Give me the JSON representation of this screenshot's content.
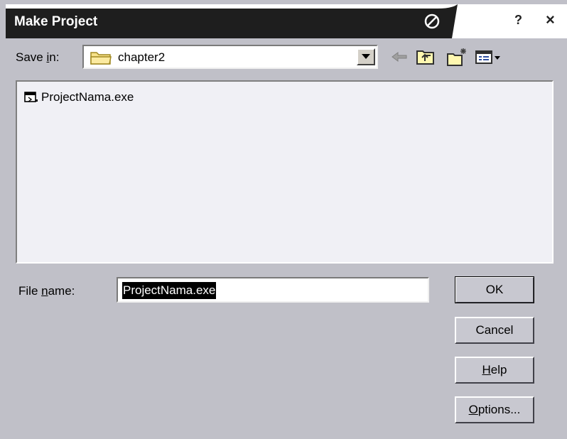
{
  "window": {
    "title": "Make Project",
    "help_label": "?",
    "close_label": "×"
  },
  "save_in": {
    "label_pre": "Save ",
    "label_accel": "i",
    "label_post": "n:",
    "folder": "chapter2"
  },
  "toolbar": {
    "icons": [
      "back-arrow-icon",
      "up-one-level-icon",
      "create-new-folder-icon",
      "view-menu-icon"
    ]
  },
  "files": [
    {
      "name": "ProjectNama.exe",
      "icon": "project-file-icon"
    }
  ],
  "file_name": {
    "label_pre": "File ",
    "label_accel": "n",
    "label_post": "ame:",
    "value": "ProjectNama.exe"
  },
  "buttons": {
    "ok": "OK",
    "cancel": "Cancel",
    "help_accel": "H",
    "help_rest": "elp",
    "options_accel": "O",
    "options_rest": "ptions..."
  },
  "colors": {
    "dialog_bg": "#c0c0c8",
    "title_bg": "#1e1e1e",
    "list_bg": "#f0f0f5",
    "toolbar_icon": "#606000"
  }
}
